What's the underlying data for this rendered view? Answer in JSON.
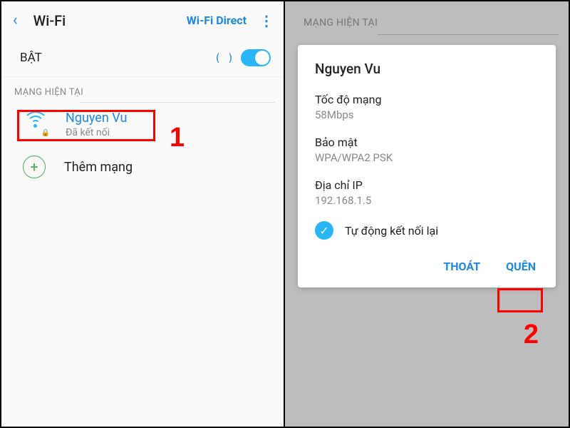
{
  "left": {
    "title": "Wi-Fi",
    "header_link": "Wi-Fi Direct",
    "toggle_label": "BẬT",
    "paren_decor": "(   )",
    "section": "MẠNG HIỆN TẠI",
    "current": {
      "name": "Nguyen Vu",
      "status": "Đã kết nối"
    },
    "add_label": "Thêm mạng"
  },
  "right": {
    "section": "MẠNG HIỆN TẠI",
    "dialog": {
      "title": "Nguyen Vu",
      "speed_label": "Tốc độ mạng",
      "speed_value": "58Mbps",
      "security_label": "Bảo mật",
      "security_value": "WPA/WPA2 PSK",
      "ip_label": "Địa chỉ IP",
      "ip_value": "192.168.1.5",
      "autoreconnect": "Tự động kết nối lại",
      "exit": "THOÁT",
      "forget": "QUÊN"
    }
  },
  "annotations": {
    "one": "1",
    "two": "2"
  }
}
